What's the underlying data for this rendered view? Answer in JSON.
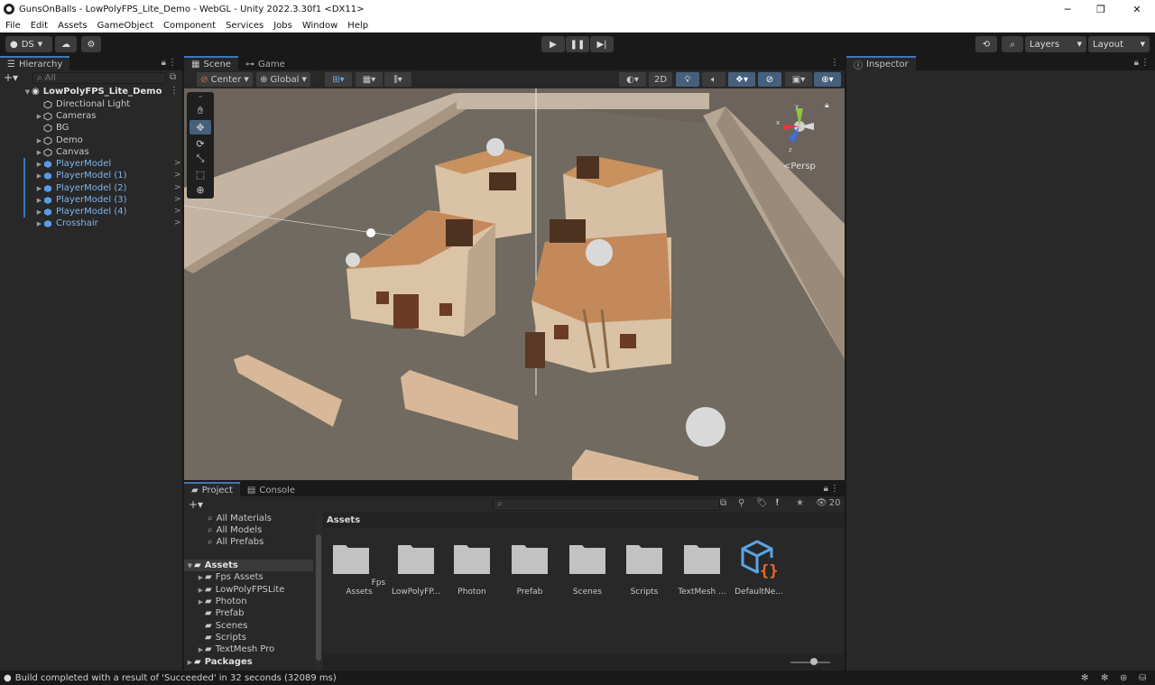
{
  "window": {
    "title": "GunsOnBalls - LowPolyFPS_Lite_Demo - WebGL - Unity 2022.3.30f1 <DX11>"
  },
  "menu": [
    "File",
    "Edit",
    "Assets",
    "GameObject",
    "Component",
    "Services",
    "Jobs",
    "Window",
    "Help"
  ],
  "toolbar": {
    "account": "DS",
    "layers": "Layers",
    "layout": "Layout"
  },
  "hierarchy": {
    "tab": "Hierarchy",
    "search_placeholder": "All",
    "scene": "LowPolyFPS_Lite_Demo",
    "items": [
      {
        "label": "Directional Light"
      },
      {
        "label": "Cameras"
      },
      {
        "label": "BG"
      },
      {
        "label": "Demo"
      },
      {
        "label": "Canvas"
      },
      {
        "label": "PlayerModel"
      },
      {
        "label": "PlayerModel (1)"
      },
      {
        "label": "PlayerModel (2)"
      },
      {
        "label": "PlayerModel (3)"
      },
      {
        "label": "PlayerModel (4)"
      },
      {
        "label": "Crosshair"
      }
    ]
  },
  "scene": {
    "tabs": [
      "Scene",
      "Game"
    ],
    "pivot": "Center",
    "space": "Global",
    "mode_2d": "2D",
    "gizmo_label": "Persp"
  },
  "inspector": {
    "tab": "Inspector"
  },
  "project": {
    "tabs": [
      "Project",
      "Console"
    ],
    "hidden_count": "20",
    "favorites": [
      "All Materials",
      "All Models",
      "All Prefabs"
    ],
    "tree_root": "Assets",
    "tree": [
      "Fps Assets",
      "LowPolyFPSLite",
      "Photon",
      "Prefab",
      "Scenes",
      "Scripts",
      "TextMesh Pro"
    ],
    "packages": "Packages",
    "breadcrumb": "Assets",
    "assets": [
      {
        "label": "Fps Assets"
      },
      {
        "label": "LowPolyFP..."
      },
      {
        "label": "Photon"
      },
      {
        "label": "Prefab"
      },
      {
        "label": "Scenes"
      },
      {
        "label": "Scripts"
      },
      {
        "label": "TextMesh ..."
      },
      {
        "label": "DefaultNe..."
      }
    ]
  },
  "status": {
    "message": "Build completed with a result of 'Succeeded' in 32 seconds (32089 ms)"
  },
  "colors": {
    "accent": "#3a79bb",
    "selected_text": "#7fb4ee",
    "panel": "#282828",
    "background": "#191919"
  }
}
